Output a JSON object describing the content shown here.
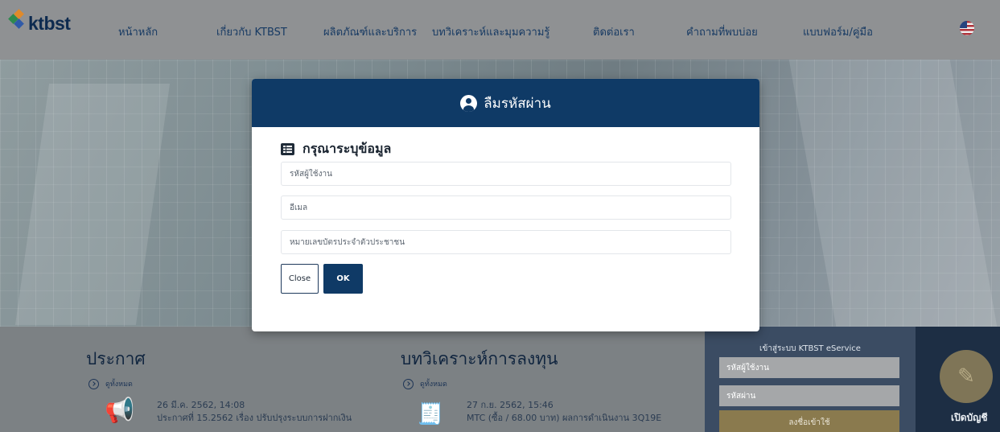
{
  "brand": {
    "logo_text": "ktbst"
  },
  "nav": {
    "items": [
      {
        "label": "หน้าหลัก"
      },
      {
        "label": "เกี่ยวกับ KTBST"
      },
      {
        "label": "ผลิตภัณฑ์และบริการ"
      },
      {
        "label": "บทวิเคราะห์และมุมความรู้"
      },
      {
        "label": "ติดต่อเรา"
      },
      {
        "label": "คำถามที่พบบ่อย"
      },
      {
        "label": "แบบฟอร์ม/คู่มือ"
      }
    ],
    "language_icon": "us-flag-icon"
  },
  "announcements": {
    "title": "ประกาศ",
    "see_all": "ดูทั้งหมด",
    "item": {
      "date": "26 มี.ค. 2562, 14:08",
      "text": "ประกาศที่ 15.2562 เรื่อง ปรับปรุงระบบการฝากเงิน"
    }
  },
  "research": {
    "title": "บทวิเคราะห์การลงทุน",
    "see_all": "ดูทั้งหมด",
    "item": {
      "date": "27 ก.ย. 2562, 15:46",
      "text": "MTC (ซื้อ / 68.00 บาท) ผลการดำเนินงาน 3Q19E"
    }
  },
  "eservice_login": {
    "title": "เข้าสู่ระบบ KTBST eService",
    "username_placeholder": "รหัสผู้ใช้งาน",
    "password_placeholder": "รหัสผ่าน",
    "submit_label": "ลงชื่อเข้าใช้"
  },
  "open_account": {
    "label": "เปิดบัญชี"
  },
  "modal": {
    "title": "ลืมรหัสผ่าน",
    "form_title": "กรุณาระบุข้อมูล",
    "fields": {
      "username_placeholder": "รหัสผู้ใช้งาน",
      "email_placeholder": "อีเมล",
      "id_card_placeholder": "หมายเลขบัตรประจำตัวประชาชน"
    },
    "close_label": "Close",
    "ok_label": "OK"
  },
  "colors": {
    "modal_header": "#0f3a66",
    "ok_button": "#0f3a66",
    "nav_text": "#173a63",
    "login_panel": "#3b4c63",
    "gold_button": "#8a7a4e"
  }
}
